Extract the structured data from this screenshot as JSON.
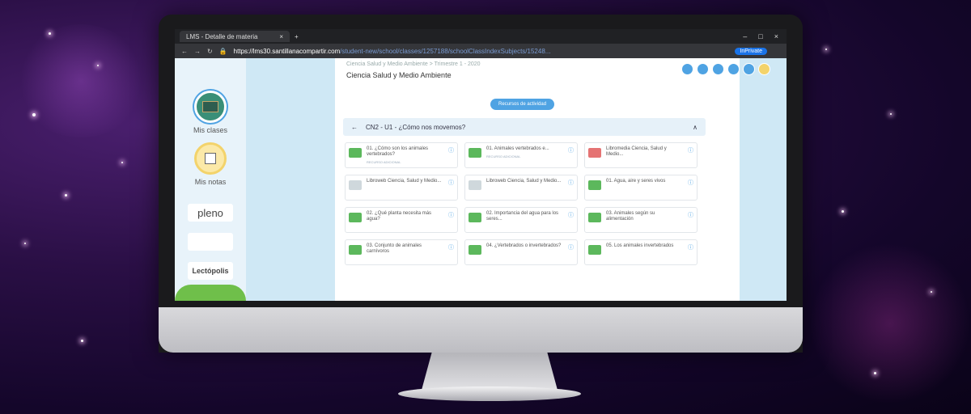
{
  "browser": {
    "tab_title": "LMS - Detalle de materia",
    "tab_close": "×",
    "new_tab": "+",
    "url": "https://lms30.santillanacompartir.com",
    "url_rest": "/student-new/school/classes/1257188/schoolClassIndexSubjects/15248...",
    "inprivate": "InPrivate",
    "window_controls": [
      "–",
      "□",
      "×"
    ]
  },
  "sidebar": {
    "items": [
      {
        "label": "Mis clases",
        "icon": "board-icon"
      },
      {
        "label": "Mis notas",
        "icon": "notes-icon"
      }
    ],
    "logos": [
      "pleno",
      "",
      "Lectópolis"
    ]
  },
  "header": {
    "breadcrumb": "Ciencia Salud y Medio Ambiente > Trimestre 1 - 2020",
    "subject_title": "Ciencia Salud y Medio Ambiente",
    "recursos_button": "Recursos de actividad"
  },
  "unit": {
    "title": "CN2 - U1 - ¿Cómo nos movemos?"
  },
  "cards": [
    {
      "title": "01. ¿Cómo son los animales vertebrados?",
      "tag": "RECURSO ADICIONAL",
      "icon": "lesson"
    },
    {
      "title": "01. Animales vertebrados e...",
      "tag": "RECURSO ADICIONAL",
      "icon": "lesson"
    },
    {
      "title": "Libromedia Ciencia, Salud y Medio...",
      "tag": "",
      "icon": "lib"
    },
    {
      "title": "Libroweb Ciencia, Salud y Medio...",
      "tag": "",
      "icon": "book"
    },
    {
      "title": "Libroweb Ciencia, Salud y Medio...",
      "tag": "",
      "icon": "book"
    },
    {
      "title": "01. Agua, aire y seres vivos",
      "tag": "",
      "icon": "lesson"
    },
    {
      "title": "02. ¿Qué planta necesita más agua?",
      "tag": "",
      "icon": "lesson"
    },
    {
      "title": "02. Importancia del agua para los seres...",
      "tag": "",
      "icon": "lesson"
    },
    {
      "title": "03. Animales según su alimentación",
      "tag": "",
      "icon": "lesson"
    },
    {
      "title": "03. Conjunto de animales carnívoros",
      "tag": "",
      "icon": "lesson"
    },
    {
      "title": "04. ¿Vertebrados o invertebrados?",
      "tag": "",
      "icon": "lesson"
    },
    {
      "title": "05. Los animales invertebrados",
      "tag": "",
      "icon": "lesson"
    }
  ],
  "colors": {
    "accent": "#4fa3e3",
    "card_icon": "#5cb85c",
    "sidebar_bg": "#e8f3fa",
    "background": "#2a0f45"
  }
}
